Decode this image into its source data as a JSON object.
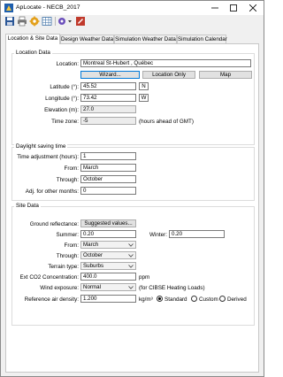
{
  "window": {
    "title": "ApLocate - NECB_2017"
  },
  "toolbar": {
    "buttons": [
      "save-icon",
      "print-icon",
      "settings-icon",
      "table-icon",
      "options-dropdown-icon",
      "edit-icon"
    ]
  },
  "tabs": [
    {
      "label": "Location & Site Data",
      "active": true
    },
    {
      "label": "Design Weather Data",
      "active": false
    },
    {
      "label": "Simulation Weather Data",
      "active": false
    },
    {
      "label": "Simulation Calendar",
      "active": false
    }
  ],
  "location_data": {
    "group_title": "Location Data",
    "location_label": "Location:",
    "location_value": "Montreal St-Hubert , Québec",
    "wizard_button": "Wizard...",
    "location_only_button": "Location Only",
    "map_button": "Map",
    "latitude_label": "Latitude (°):",
    "latitude_value": "45.52",
    "latitude_hemisphere": "N",
    "longitude_label": "Longitude (°):",
    "longitude_value": "73.42",
    "longitude_hemisphere": "W",
    "elevation_label": "Elevation (m):",
    "elevation_value": "27.0",
    "timezone_label": "Time zone:",
    "timezone_value": "-5",
    "timezone_note": "(hours ahead of GMT)"
  },
  "daylight_saving": {
    "group_title": "Daylight saving time",
    "adjustment_label": "Time adjustment (hours):",
    "adjustment_value": "1",
    "from_label": "From:",
    "from_value": "March",
    "through_label": "Through:",
    "through_value": "October",
    "other_label": "Adj. for other months:",
    "other_value": "0"
  },
  "site_data": {
    "group_title": "Site Data",
    "ground_reflectance_label": "Ground reflectance:",
    "suggested_values_button": "Suggested values...",
    "summer_label": "Summer:",
    "summer_value": "0.20",
    "winter_label": "Winter:",
    "winter_value": "0.20",
    "from_label": "From:",
    "from_value": "March",
    "through_label": "Through:",
    "through_value": "October",
    "terrain_label": "Terrain type:",
    "terrain_value": "Suburbs",
    "co2_label": "Ext CO2 Concentration:",
    "co2_value": "400.0",
    "co2_unit": "ppm",
    "wind_label": "Wind exposure:",
    "wind_value": "Normal",
    "wind_note": "(for CIBSE Heating Loads)",
    "air_density_label": "Reference air density:",
    "air_density_value": "1.200",
    "air_density_unit": "kg/m³",
    "density_options": [
      {
        "label": "Standard",
        "selected": true
      },
      {
        "label": "Custom",
        "selected": false
      },
      {
        "label": "Derived",
        "selected": false
      }
    ]
  },
  "colors": {
    "accent": "#0078d7",
    "panel": "#ffffff",
    "window": "#f0f0f0"
  }
}
